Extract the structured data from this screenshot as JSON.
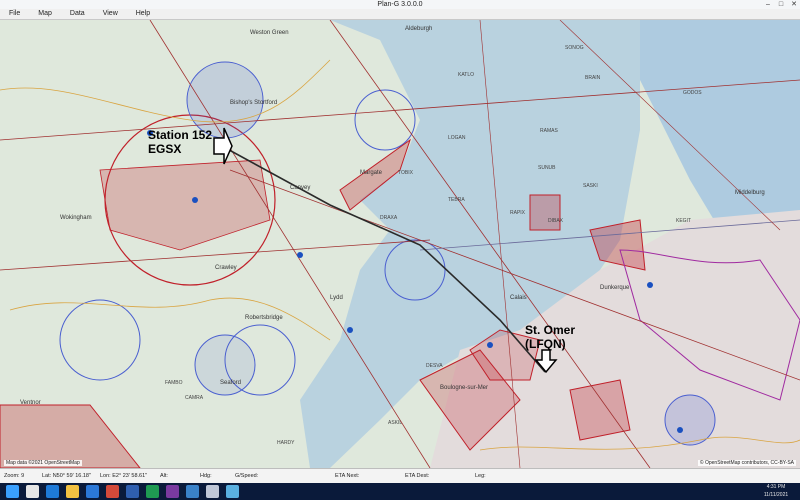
{
  "window": {
    "title": "Plan-G 3.0.0.0"
  },
  "menu": [
    "File",
    "Map",
    "Data",
    "View",
    "Help"
  ],
  "map": {
    "airfields": [
      {
        "name": "Station 152",
        "code": "EGSX"
      },
      {
        "name": "St. Omer",
        "code": "(LFQN)"
      }
    ],
    "places": [
      "Aldeburgh",
      "Weston Green",
      "Bishop's Stortford",
      "Wokingham",
      "Crawley",
      "Robertsbridge",
      "Seaford",
      "Ventnor",
      "Margate",
      "Canvey",
      "Lydd",
      "Boulogne-sur-Mer",
      "Dunkerque",
      "Calais",
      "Middelburg"
    ],
    "waypoints": [
      "SONOG",
      "BRAIN",
      "KATLO",
      "GODOS",
      "LOGAN",
      "TOBIX",
      "TEBRA",
      "SASKI",
      "DRAXA",
      "RAPIX",
      "DIBAX",
      "KEGIT",
      "SUNUB",
      "FAMBO",
      "RAMAS",
      "CAMRA",
      "HARDY",
      "DESVA",
      "ASKIL"
    ],
    "osm_credit": "© OpenStreetMap contributors, CC-BY-SA",
    "scale_label": "Map data ©2021 OpenStreetMap"
  },
  "status": {
    "zoom_label": "Zoom: 9",
    "lat_label": "Lat: N50° 59' 16.18\"",
    "lon_label": "Lon: E2° 23' 58.61\"",
    "alt_label": "Alt:",
    "hdg_label": "Hdg:",
    "gspeed_label": "G/Speed:",
    "eta_next_label": "ETA Next:",
    "eta_dest_label": "ETA Dest:",
    "leg_label": "Leg:"
  },
  "taskbar": {
    "time": "4:31 PM",
    "date": "11/11/2021"
  },
  "colors": {
    "land": "#dfe8dc",
    "sea": "#b9d2df",
    "airspace_red": "#c0202a",
    "airspace_blue": "#4a5fd0",
    "airspace_magenta": "#a02aa0"
  }
}
